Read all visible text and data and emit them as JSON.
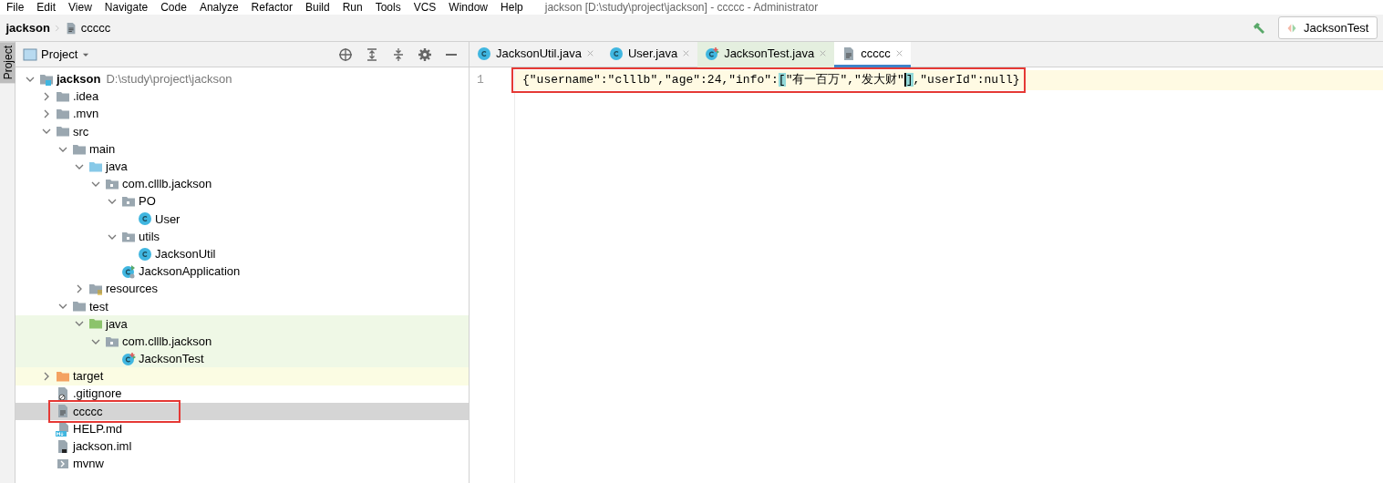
{
  "menu_bar": {
    "items": [
      "File",
      "Edit",
      "View",
      "Navigate",
      "Code",
      "Analyze",
      "Refactor",
      "Build",
      "Run",
      "Tools",
      "VCS",
      "Window",
      "Help"
    ],
    "title": "jackson [D:\\study\\project\\jackson] - ccccc - Administrator"
  },
  "breadcrumb": [
    "jackson",
    "ccccc"
  ],
  "toolbar": {
    "run_config": "JacksonTest"
  },
  "side_strip": {
    "tabs": [
      {
        "label": "Project",
        "selected": true
      }
    ]
  },
  "project_panel": {
    "title": "Project",
    "tree": [
      {
        "label": "jackson",
        "path": "D:\\study\\project\\jackson",
        "kind": "module",
        "expanded": true,
        "selected": false,
        "children": [
          {
            "label": ".idea",
            "kind": "folder",
            "expanded": false,
            "selected": false
          },
          {
            "label": ".mvn",
            "kind": "folder",
            "expanded": false,
            "selected": false
          },
          {
            "label": "src",
            "kind": "folder",
            "expanded": true,
            "selected": false,
            "children": [
              {
                "label": "main",
                "kind": "folder",
                "expanded": true,
                "selected": false,
                "children": [
                  {
                    "label": "java",
                    "kind": "source-folder",
                    "expanded": true,
                    "selected": false,
                    "children": [
                      {
                        "label": "com.clllb.jackson",
                        "kind": "package",
                        "expanded": true,
                        "selected": false,
                        "children": [
                          {
                            "label": "PO",
                            "kind": "package",
                            "expanded": true,
                            "selected": false,
                            "children": [
                              {
                                "label": "User",
                                "kind": "class",
                                "selected": false
                              }
                            ]
                          },
                          {
                            "label": "utils",
                            "kind": "package",
                            "expanded": true,
                            "selected": false,
                            "children": [
                              {
                                "label": "JacksonUtil",
                                "kind": "class",
                                "selected": false
                              }
                            ]
                          },
                          {
                            "label": "JacksonApplication",
                            "kind": "app-class",
                            "selected": false
                          }
                        ]
                      }
                    ]
                  },
                  {
                    "label": "resources",
                    "kind": "resources-folder",
                    "expanded": false,
                    "selected": false
                  }
                ]
              },
              {
                "label": "test",
                "kind": "folder",
                "expanded": true,
                "selected": false,
                "children": [
                  {
                    "label": "java",
                    "kind": "test-folder",
                    "in_test_sources": true,
                    "expanded": true,
                    "selected": false,
                    "children": [
                      {
                        "label": "com.clllb.jackson",
                        "kind": "package",
                        "in_test_sources": true,
                        "expanded": true,
                        "selected": false,
                        "children": [
                          {
                            "label": "JacksonTest",
                            "kind": "test-class",
                            "in_test_sources": true,
                            "selected": false
                          }
                        ]
                      }
                    ]
                  }
                ]
              }
            ]
          },
          {
            "label": "target",
            "kind": "excluded-folder",
            "excluded": true,
            "expanded": false,
            "selected": false
          },
          {
            "label": ".gitignore",
            "kind": "gitignore",
            "selected": false
          },
          {
            "label": "ccccc",
            "kind": "text-file",
            "selected": true,
            "annotated": true
          },
          {
            "label": "HELP.md",
            "kind": "markdown",
            "selected": false
          },
          {
            "label": "jackson.iml",
            "kind": "iml",
            "selected": false
          },
          {
            "label": "mvnw",
            "kind": "script",
            "selected": false
          }
        ]
      }
    ]
  },
  "editor": {
    "tabs": [
      {
        "label": "JacksonUtil.java",
        "kind": "class",
        "selected": false
      },
      {
        "label": "User.java",
        "kind": "class",
        "selected": false
      },
      {
        "label": "JacksonTest.java",
        "kind": "test-class",
        "selected": false
      },
      {
        "label": "ccccc",
        "kind": "text-file",
        "selected": true
      }
    ],
    "lines": [
      {
        "number": "1",
        "annotated": true,
        "segments": [
          {
            "text": "{\"username\":\"clllb\",\"age\":24,\"info\":",
            "kind": "plain"
          },
          {
            "text": "[",
            "kind": "bracket"
          },
          {
            "text": "\"有一百万\",\"发大财\"",
            "kind": "plain"
          },
          {
            "text": "]",
            "kind": "bracket",
            "caret_before": true
          },
          {
            "text": ",\"userId\":null}",
            "kind": "plain"
          }
        ]
      }
    ]
  }
}
